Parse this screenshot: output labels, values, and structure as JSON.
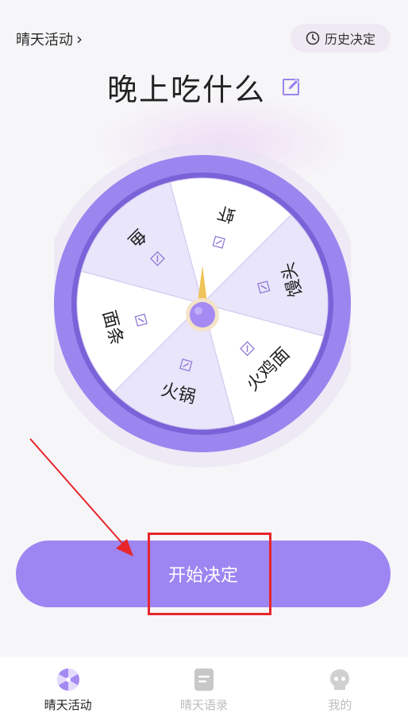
{
  "header": {
    "activity_link": "晴天活动",
    "history_button": "历史决定"
  },
  "title": "晚上吃什么",
  "wheel": {
    "segments": [
      "虾",
      "馒头",
      "火鸡面",
      "火锅",
      "面条",
      "鱼"
    ],
    "colors": {
      "rim": "#9b85ef",
      "inner_ring": "#7a62d8",
      "segment_light": "#ffffff",
      "segment_shade": "#e9e5fa",
      "pointer": "#f0c45a",
      "hub": "#a48af2"
    }
  },
  "start_button": "开始决定",
  "colors": {
    "accent": "#9d85f2",
    "annotation_red": "#e6262b"
  },
  "tabbar": {
    "items": [
      {
        "label": "晴天活动",
        "icon": "wheel-icon",
        "active": true
      },
      {
        "label": "晴天语录",
        "icon": "note-icon",
        "active": false
      },
      {
        "label": "我的",
        "icon": "profile-icon",
        "active": false
      }
    ]
  }
}
